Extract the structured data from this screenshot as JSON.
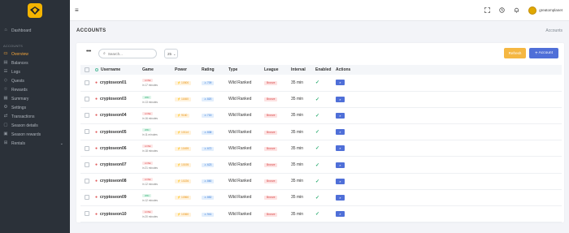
{
  "sidebar": {
    "logo_icon": "diamond-logo-icon",
    "items_top": [
      {
        "label": "Dashboard",
        "icon": "home-icon"
      }
    ],
    "section_label": "ACCOUNTS",
    "items": [
      {
        "label": "Overview",
        "icon": "monitor-icon",
        "active": true
      },
      {
        "label": "Balances",
        "icon": "wallet-icon"
      },
      {
        "label": "Logs",
        "icon": "logs-icon"
      },
      {
        "label": "Quests",
        "icon": "quest-icon"
      },
      {
        "label": "Rewards",
        "icon": "rewards-icon"
      },
      {
        "label": "Summary",
        "icon": "summary-icon"
      },
      {
        "label": "Settings",
        "icon": "gear-icon"
      },
      {
        "label": "Transactions",
        "icon": "transactions-icon"
      },
      {
        "label": "Season details",
        "icon": "season-icon"
      },
      {
        "label": "Season rewards",
        "icon": "season-rewards-icon"
      },
      {
        "label": "Rentals",
        "icon": "rentals-icon"
      }
    ]
  },
  "topbar": {
    "menu_icon": "hamburger-icon",
    "username": "greatomplanet"
  },
  "page": {
    "title": "ACCOUNTS",
    "breadcrumb": "Accounts"
  },
  "toolbar": {
    "search_placeholder": "Search...",
    "page_size": "25",
    "refresh_label": "Refresh",
    "add_account_label": "Account",
    "accent_blue": "#4f6fd8",
    "accent_orange": "#f5b742"
  },
  "table": {
    "headers": {
      "username": "Username",
      "game": "Game",
      "power": "Power",
      "rating": "Rating",
      "type": "Type",
      "league": "League",
      "interval": "Interval",
      "enabled": "Enabled",
      "actions": "Actions"
    },
    "rows": [
      {
        "username": "cryptoseon01",
        "result": "LOSE",
        "time": "in 17 minutes",
        "power": "10500",
        "rating": "709",
        "type": "Wild Ranked",
        "league": "Bronze",
        "interval": "35 min"
      },
      {
        "username": "cryptoseon03",
        "result": "WIN",
        "time": "in 13 minutes",
        "power": "11660",
        "rating": "820",
        "type": "Wild Ranked",
        "league": "Bronze",
        "interval": "35 min"
      },
      {
        "username": "cryptoseon04",
        "result": "LOSE",
        "time": "in 16 minutes",
        "power": "9160",
        "rating": "715",
        "type": "Wild Ranked",
        "league": "Bronze",
        "interval": "35 min"
      },
      {
        "username": "cryptoseon05",
        "result": "WIN",
        "time": "in 11 minutes",
        "power": "10114",
        "rating": "838",
        "type": "Wild Ranked",
        "league": "Bronze",
        "interval": "35 min"
      },
      {
        "username": "cryptoseon06",
        "result": "LOSE",
        "time": "in 18 minutes",
        "power": "10499",
        "rating": "672",
        "type": "Wild Ranked",
        "league": "Bronze",
        "interval": "35 min"
      },
      {
        "username": "cryptoseon07",
        "result": "LOSE",
        "time": "in 21 minutes",
        "power": "10195",
        "rating": "623",
        "type": "Wild Ranked",
        "league": "Bronze",
        "interval": "35 min"
      },
      {
        "username": "cryptoseon08",
        "result": "LOSE",
        "time": "in 12 minutes",
        "power": "10226",
        "rating": "860",
        "type": "Wild Ranked",
        "league": "Bronze",
        "interval": "35 min"
      },
      {
        "username": "cryptoseon09",
        "result": "WIN",
        "time": "in 12 minutes",
        "power": "10560",
        "rating": "852",
        "type": "Wild Ranked",
        "league": "Bronze",
        "interval": "35 min"
      },
      {
        "username": "cryptoseon10",
        "result": "LOSE",
        "time": "in 20 minutes",
        "power": "10360",
        "rating": "941",
        "type": "Wild Ranked",
        "league": "Bronze",
        "interval": "35 min"
      }
    ]
  }
}
